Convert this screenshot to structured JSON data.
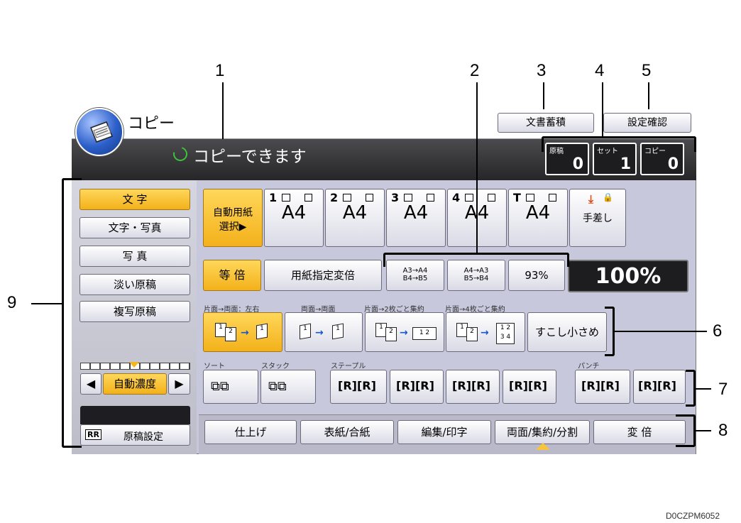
{
  "app": {
    "title": "コピー",
    "status": "コピーできます"
  },
  "header": {
    "doc_storage": "文書蓄積",
    "settings_check": "設定確認"
  },
  "counters": [
    {
      "label": "原稿",
      "value": "0"
    },
    {
      "label": "セット",
      "value": "1"
    },
    {
      "label": "コピー",
      "value": "0"
    }
  ],
  "original_types": [
    "文 字",
    "文字・写真",
    "写 真",
    "淡い原稿",
    "複写原稿"
  ],
  "density": {
    "label": "自動濃度",
    "left": "◀",
    "right": "▶"
  },
  "original_settings": {
    "label": "原稿設定",
    "icon_text": "RR"
  },
  "paper": {
    "auto_label_line1": "自動用紙",
    "auto_label_line2": "選択▶",
    "trays": [
      {
        "num": "1",
        "size": "A4"
      },
      {
        "num": "2",
        "size": "A4"
      },
      {
        "num": "3",
        "size": "A4"
      },
      {
        "num": "4",
        "size": "A4"
      },
      {
        "num": "T",
        "size": "A4"
      }
    ],
    "bypass": "手差し"
  },
  "ratio": {
    "full_size": "等 倍",
    "specify_paper": "用紙指定変倍",
    "presets": [
      {
        "line1": "A3→A4",
        "line2": "B4→B5"
      },
      {
        "line1": "A4→A3",
        "line2": "B5→B4"
      }
    ],
    "percent_button": "93%",
    "display": "100%"
  },
  "duplex": {
    "labels": [
      "片面→両面：左右",
      "両面→両面",
      "片面→2枚ごと集約",
      "片面→4枚ごと集約"
    ],
    "slightly_smaller": "すこし小さめ"
  },
  "finishing": {
    "sort_label": "ソート",
    "stack_label": "スタック",
    "staple_label": "ステープル",
    "punch_label": "パンチ"
  },
  "bottom_tabs": [
    "仕上げ",
    "表紙/合紙",
    "編集/印字",
    "両面/集約/分割",
    "変 倍"
  ],
  "callouts": [
    "1",
    "2",
    "3",
    "4",
    "5",
    "6",
    "7",
    "8",
    "9"
  ],
  "figure_code": "D0CZPM6052"
}
